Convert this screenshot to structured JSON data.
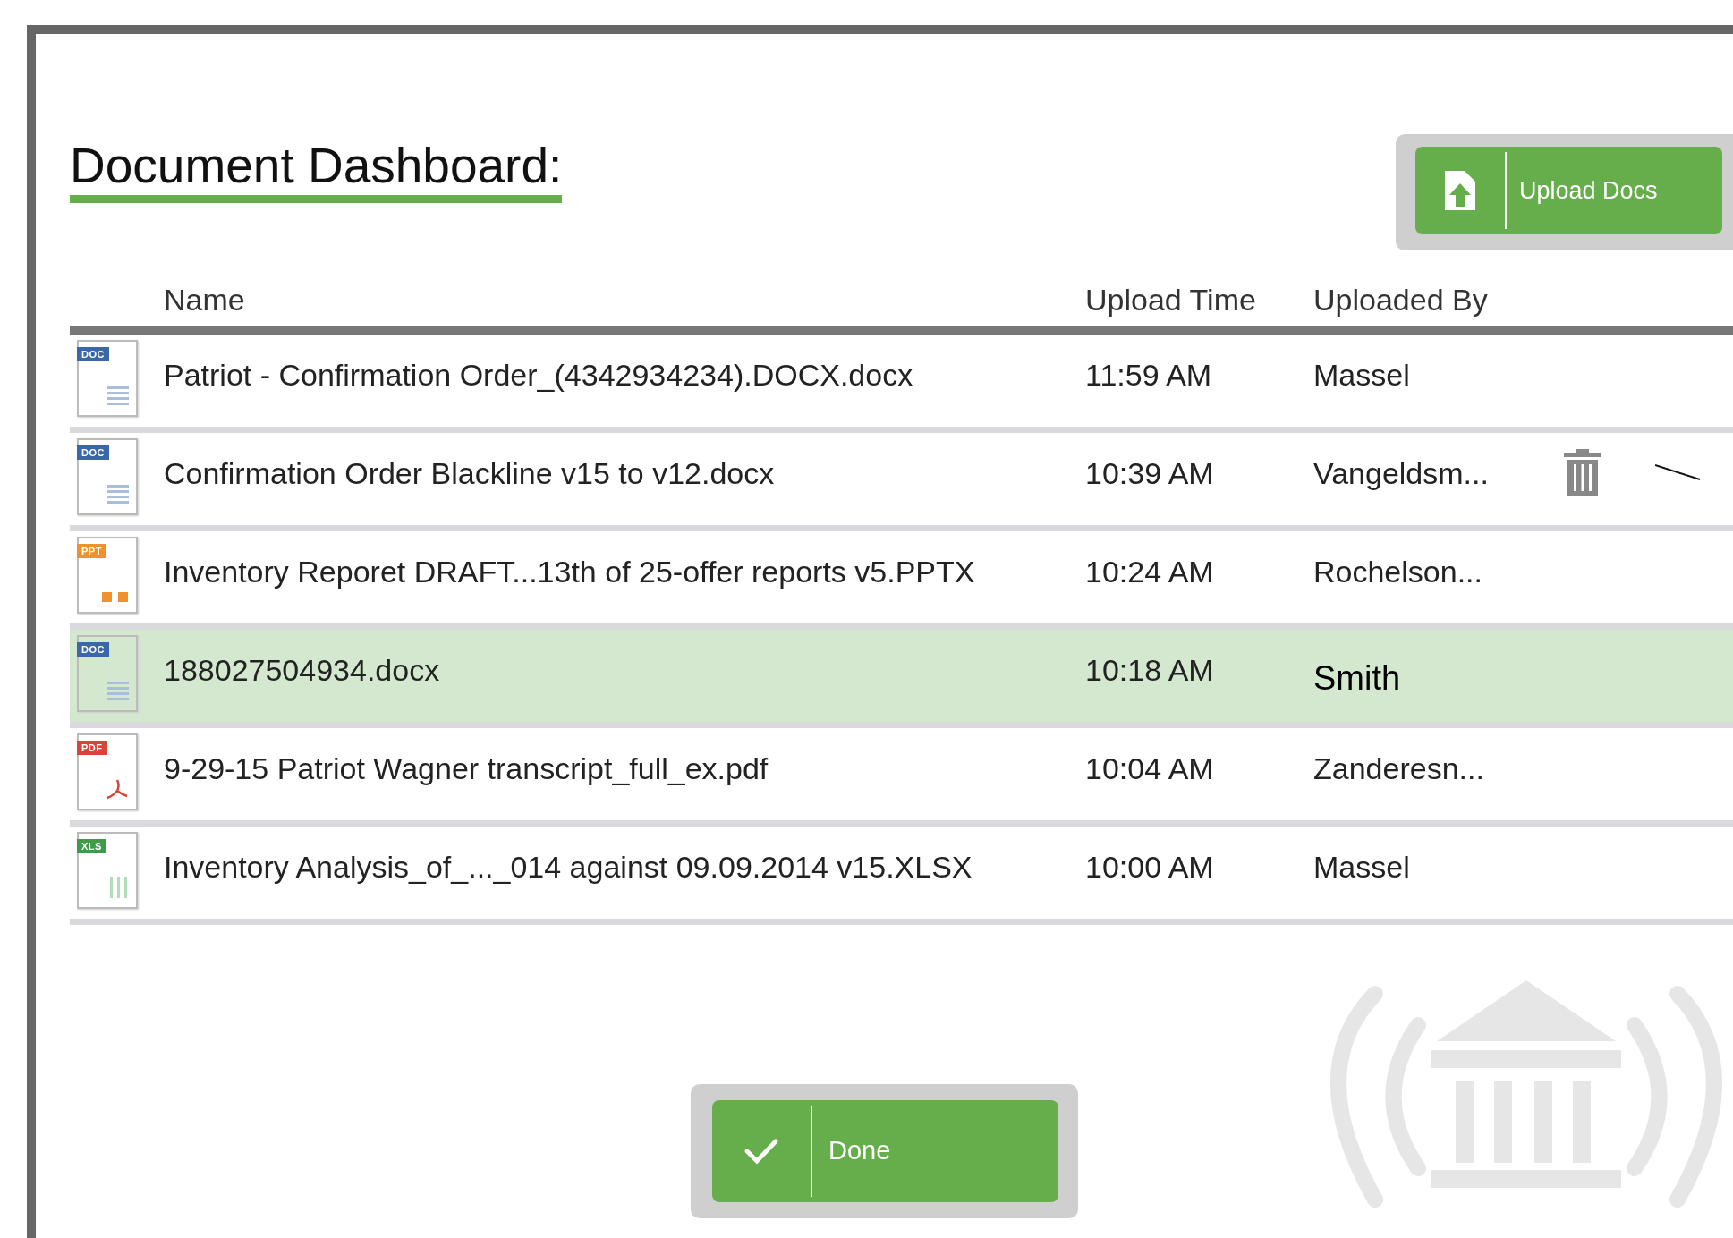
{
  "title": "Document Dashboard:",
  "upload_button": {
    "label": "Upload Docs"
  },
  "table": {
    "columns": [
      "Name",
      "Upload Time",
      "Uploaded By"
    ],
    "rows": [
      {
        "kind": "doc",
        "badge": "DOC",
        "name": "Patriot - Confirmation Order_(4342934234).DOCX.docx",
        "time": "11:59 AM",
        "by": "Massel",
        "selected": false,
        "delete_icon": false,
        "leader_line": false
      },
      {
        "kind": "doc",
        "badge": "DOC",
        "name": "Confirmation Order Blackline v15 to v12.docx",
        "time": "10:39 AM",
        "by": "Vangeldsm...",
        "selected": false,
        "delete_icon": true,
        "leader_line": true
      },
      {
        "kind": "ppt",
        "badge": "PPT",
        "name": "Inventory Reporet DRAFT...13th of 25-offer reports v5.PPTX",
        "time": "10:24 AM",
        "by": "Rochelson...",
        "selected": false,
        "delete_icon": false,
        "leader_line": false
      },
      {
        "kind": "doc",
        "badge": "DOC",
        "name": "188027504934.docx",
        "time": "10:18 AM",
        "by": "Smith",
        "selected": true,
        "delete_icon": false,
        "leader_line": false
      },
      {
        "kind": "pdf",
        "badge": "PDF",
        "name": "9-29-15 Patriot Wagner transcript_full_ex.pdf",
        "time": "10:04 AM",
        "by": "Zanderesn...",
        "selected": false,
        "delete_icon": false,
        "leader_line": false
      },
      {
        "kind": "xls",
        "badge": "XLS",
        "name": "Inventory Analysis_of_..._014 against 09.09.2014 v15.XLSX",
        "time": "10:00 AM",
        "by": "Massel",
        "selected": false,
        "delete_icon": false,
        "leader_line": false
      }
    ]
  },
  "done_button": {
    "label": "Done"
  }
}
